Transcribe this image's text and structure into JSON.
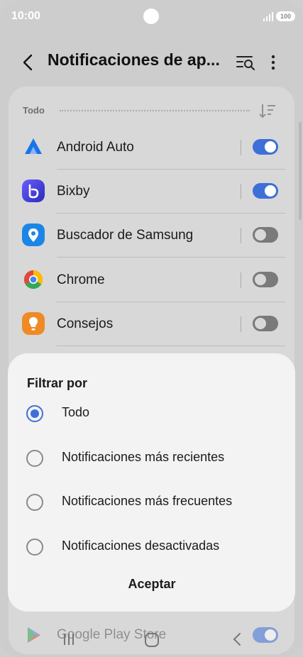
{
  "status_bar": {
    "time": "10:00",
    "battery": "100"
  },
  "header": {
    "title": "Notificaciones de ap...",
    "back_icon": "back-arrow-icon",
    "filter_icon": "filter-search-icon",
    "more_icon": "more-vertical-icon"
  },
  "list": {
    "section_label": "Todo",
    "sort_icon": "sort-icon",
    "apps": [
      {
        "label": "Android Auto",
        "icon": "android-auto-icon",
        "enabled": true,
        "color": "#1a73e8"
      },
      {
        "label": "Bixby",
        "icon": "bixby-icon",
        "enabled": true,
        "color": "#4b3ccf"
      },
      {
        "label": "Buscador de Samsung",
        "icon": "samsung-finder-icon",
        "enabled": false,
        "color": "#1c86e6"
      },
      {
        "label": "Chrome",
        "icon": "chrome-icon",
        "enabled": false,
        "color": "#e04a3b"
      },
      {
        "label": "Consejos",
        "icon": "tips-icon",
        "enabled": false,
        "color": "#f08a24"
      }
    ],
    "peek_app": {
      "label": "Google Play Store",
      "icon": "play-store-icon",
      "enabled": true
    }
  },
  "sheet": {
    "title": "Filtrar por",
    "options": [
      {
        "label": "Todo",
        "checked": true
      },
      {
        "label": "Notificaciones más recientes",
        "checked": false
      },
      {
        "label": "Notificaciones más frecuentes",
        "checked": false
      },
      {
        "label": "Notificaciones desactivadas",
        "checked": false
      }
    ],
    "accept_label": "Aceptar"
  },
  "colors": {
    "accent": "#3e6fd8",
    "sheet_bg": "#f3f3f4",
    "backdrop": "#cdcdcd"
  },
  "nav": {
    "recents_icon": "recents-icon",
    "home_icon": "home-icon",
    "back_icon": "nav-back-icon"
  }
}
